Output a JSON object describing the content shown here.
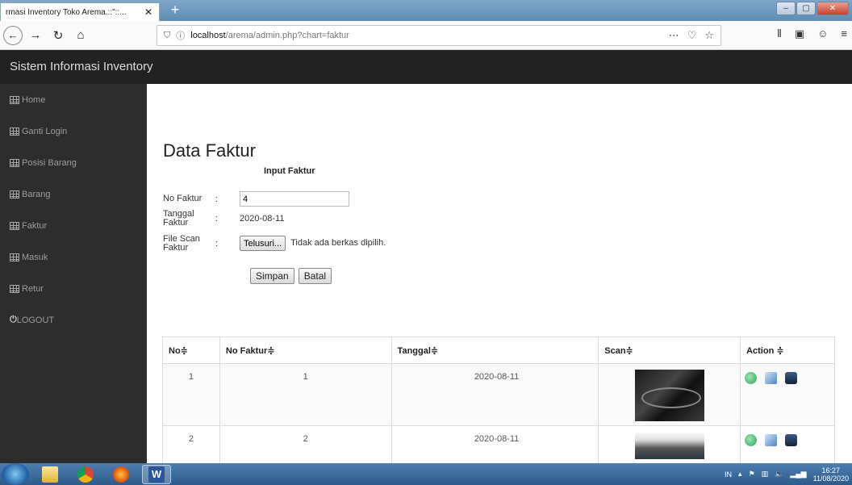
{
  "browser": {
    "tab_title": "rmasi Inventory Toko Arema.::\"::...",
    "tab_close": "✕",
    "new_tab": "+",
    "url_host": "localhost",
    "url_path": "/arema/admin.php?chart=faktur",
    "minimize": "–",
    "maximize": "▢",
    "close": "✕"
  },
  "app": {
    "title": "Sistem Informasi Inventory"
  },
  "sidebar": {
    "items": [
      {
        "label": "Home",
        "icon": "grid-icon"
      },
      {
        "label": "Ganti Login",
        "icon": "grid-icon"
      },
      {
        "label": "Posisi Barang",
        "icon": "grid-icon"
      },
      {
        "label": "Barang",
        "icon": "grid-icon"
      },
      {
        "label": "Faktur",
        "icon": "grid-icon"
      },
      {
        "label": "Masuk",
        "icon": "grid-icon"
      },
      {
        "label": "Retur",
        "icon": "grid-icon"
      },
      {
        "label": "LOGOUT",
        "icon": "power-icon"
      }
    ]
  },
  "main": {
    "page_title": "Data Faktur",
    "form_title": "Input Faktur",
    "form": {
      "no_faktur_label": "No Faktur",
      "no_faktur_value": "4",
      "tanggal_label": "Tanggal Faktur",
      "tanggal_value": "2020-08-11",
      "file_label": "File Scan Faktur",
      "file_button": "Telusuri...",
      "file_status": "Tidak ada berkas dipilih.",
      "separator": ":"
    },
    "buttons": {
      "save": "Simpan",
      "cancel": "Batal"
    },
    "table": {
      "headers": [
        "No≑",
        "No Faktur≑",
        "Tanggal≑",
        "Scan≑",
        "Action ≑"
      ],
      "rows": [
        {
          "no": "1",
          "no_faktur": "1",
          "tanggal": "2020-08-11"
        },
        {
          "no": "2",
          "no_faktur": "2",
          "tanggal": "2020-08-11"
        }
      ]
    }
  },
  "taskbar": {
    "word_label": "W",
    "lang": "IN",
    "time": "16:27",
    "date": "11/08/2020"
  }
}
